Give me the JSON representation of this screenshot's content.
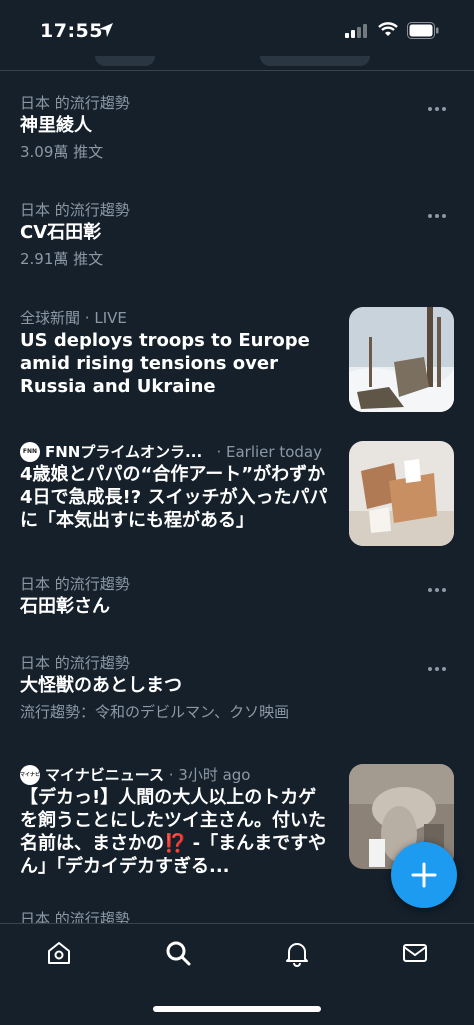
{
  "status": {
    "time": "17:55"
  },
  "trends": [
    {
      "meta": "日本 的流行趨勢",
      "title": "神里綾人",
      "count": "3.09萬 推文"
    },
    {
      "meta": "日本 的流行趨勢",
      "title": "CV石田彰",
      "count": "2.91萬 推文"
    },
    {
      "meta": "日本 的流行趨勢",
      "title": "石田彰さん"
    },
    {
      "meta": "日本 的流行趨勢",
      "title": "大怪獣のあとしまつ",
      "count": "流行趨勢：令和のデビルマン、クソ映画"
    },
    {
      "meta": "日本 的流行趨勢"
    }
  ],
  "news": [
    {
      "category": "全球新聞",
      "tag": "· LIVE",
      "title": "US deploys troops to Europe amid rising tensions over Russia and Ukraine"
    },
    {
      "source": "FNNプライムオンラ...",
      "time": "· Earlier today",
      "logo_text": "FNN",
      "title": "4歳娘とパパの“合作アート”がわずか4日で急成長!? スイッチが入ったパパに「本気出すにも程がある」"
    },
    {
      "source": "マイナビニュース",
      "time": "· 3小时 ago",
      "logo_text": "マイナビ",
      "title": "【デカっ!】人間の大人以上のトカゲを飼うことにしたツイ主さん。付いた名前は、まさかの⁉️ -「まんまですやん」「デカイデカすぎる..."
    }
  ],
  "colors": {
    "accent": "#1d9bf0",
    "background": "#15202b",
    "secondary_text": "#8b98a5"
  }
}
